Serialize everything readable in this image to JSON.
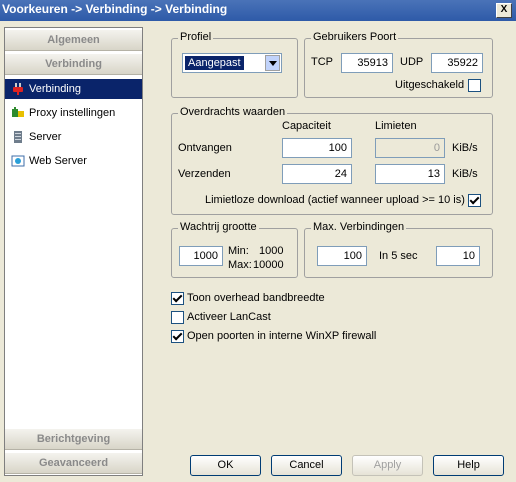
{
  "window": {
    "title": "Voorkeuren -> Verbinding -> Verbinding",
    "close_label": "X"
  },
  "sidebar": {
    "sections": {
      "algemeen": "Algemeen",
      "verbinding": "Verbinding",
      "berichtgeving": "Berichtgeving",
      "geavanceerd": "Geavanceerd"
    },
    "items": [
      {
        "label": "Verbinding",
        "icon": "plug-icon"
      },
      {
        "label": "Proxy instellingen",
        "icon": "proxy-icon"
      },
      {
        "label": "Server",
        "icon": "server-icon"
      },
      {
        "label": "Web Server",
        "icon": "web-server-icon"
      }
    ]
  },
  "profiel": {
    "title": "Profiel",
    "selected": "Aangepast"
  },
  "ports": {
    "title": "Gebruikers Poort",
    "tcp_label": "TCP",
    "tcp_value": "35913",
    "udp_label": "UDP",
    "udp_value": "35922",
    "disabled_label": "Uitgeschakeld"
  },
  "transfer": {
    "title": "Overdrachts waarden",
    "capacity_header": "Capaciteit",
    "limits_header": "Limieten",
    "receive_label": "Ontvangen",
    "receive_capacity": "100",
    "receive_limit": "0",
    "send_label": "Verzenden",
    "send_capacity": "24",
    "send_limit": "13",
    "unit": "KiB/s",
    "unlimited_label": "Limietloze download (actief wanneer upload >= 10 is)"
  },
  "queue": {
    "title": "Wachtrij grootte",
    "value": "1000",
    "min_label": "Min:",
    "min_value": "1000",
    "max_label": "Max:",
    "max_value": "10000"
  },
  "maxconn": {
    "title": "Max. Verbindingen",
    "value": "100",
    "per_label": "In 5 sec",
    "per_value": "10"
  },
  "options": {
    "overhead": "Toon overhead bandbreedte",
    "lancast": "Activeer LanCast",
    "firewall": "Open poorten in interne WinXP firewall"
  },
  "buttons": {
    "ok": "OK",
    "cancel": "Cancel",
    "apply": "Apply",
    "help": "Help"
  }
}
